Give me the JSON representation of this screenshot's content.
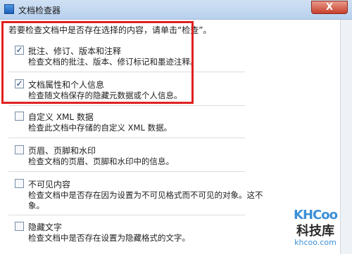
{
  "window": {
    "title": "文档检查器",
    "close_label": "X"
  },
  "instruction": "若要检查文档中是否存在选择的内容，请单击“检查”。",
  "items": [
    {
      "title": "批注、修订、版本和注释",
      "desc": "检查文档的批注、版本、修订标记和墨迹注释。",
      "checked": true
    },
    {
      "title": "文档属性和个人信息",
      "desc": "检查随文档保存的隐藏元数据或个人信息。",
      "checked": true
    },
    {
      "title": "自定义 XML 数据",
      "desc": "检查此文档中存储的自定义 XML 数据。",
      "checked": false
    },
    {
      "title": "页眉、页脚和水印",
      "desc": "检查文档的页眉、页脚和水印中的信息。",
      "checked": false
    },
    {
      "title": "不可见内容",
      "desc": "检查文档中是否存在因为设置为不可见格式而不可见的对象。这不",
      "desc2": "象。",
      "checked": false
    },
    {
      "title": "隐藏文字",
      "desc": "检查文档中是否存在设置为隐藏格式的文字。",
      "checked": false
    }
  ],
  "check_glyph": "✓",
  "watermark": {
    "logo": "KHCoo",
    "cn": "科技库",
    "url": "khcoo.com"
  }
}
